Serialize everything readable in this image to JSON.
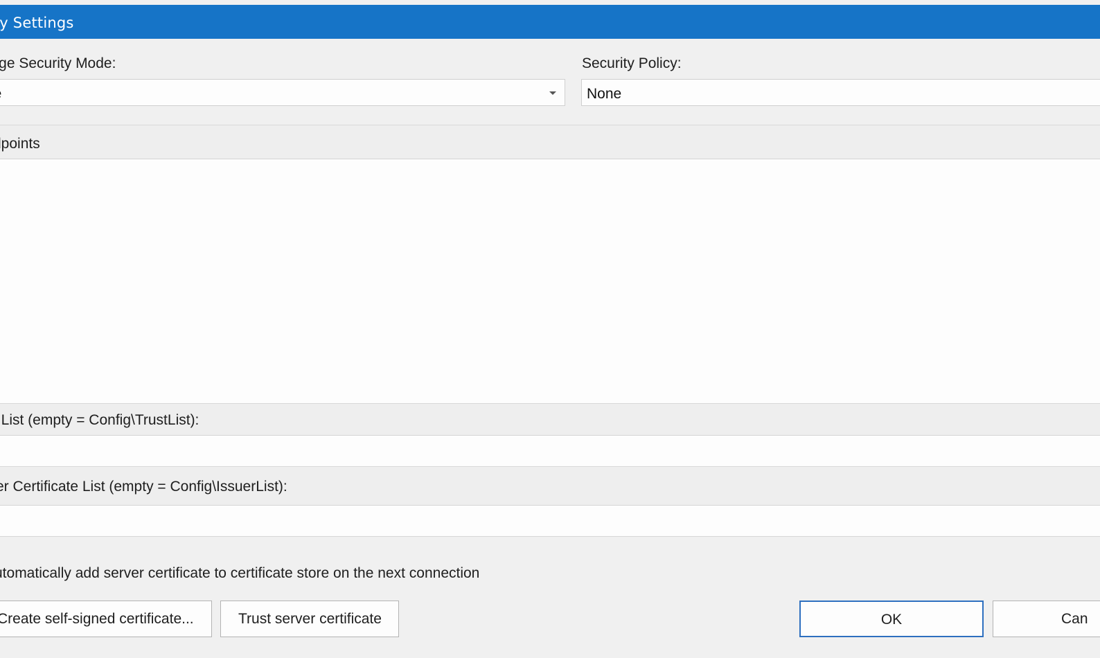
{
  "window": {
    "title": "rity Settings"
  },
  "message_security_mode": {
    "label": "sage Security Mode:",
    "value": "ne",
    "icon": "chevron-down-icon"
  },
  "security_policy": {
    "label": "Security Policy:",
    "value": "None"
  },
  "endpoints": {
    "header": "dpoints"
  },
  "trust_list": {
    "label": "t List (empty = Config\\TrustList):",
    "value": ""
  },
  "issuer_list": {
    "label": "er Certificate List (empty = Config\\IssuerList):",
    "value": ""
  },
  "auto_add": {
    "label": "utomatically add server certificate to certificate store on the next connection"
  },
  "buttons": {
    "create_cert": "Create self-signed certificate...",
    "trust_server": "Trust server certificate",
    "ok": "OK",
    "cancel": "Can"
  },
  "colors": {
    "titlebar": "#1674c7",
    "dialog_bg": "#f0f0f0",
    "primary_border": "#2d6fbf"
  }
}
